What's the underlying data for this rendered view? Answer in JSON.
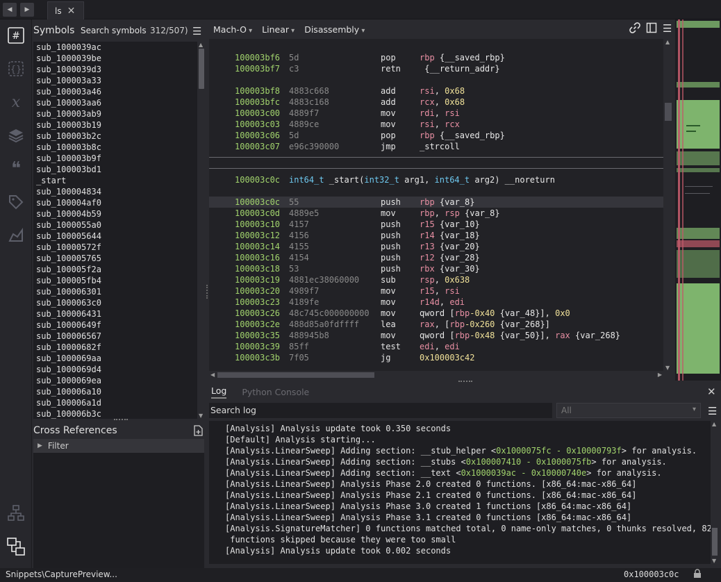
{
  "tab": {
    "title": "ls"
  },
  "symbols": {
    "title": "Symbols",
    "search_label": "Search symbols",
    "count": "312/507)",
    "items": [
      "sub_1000039ac",
      "sub_1000039be",
      "sub_1000039d3",
      "sub_100003a33",
      "sub_100003a46",
      "sub_100003aa6",
      "sub_100003ab9",
      "sub_100003b19",
      "sub_100003b2c",
      "sub_100003b8c",
      "sub_100003b9f",
      "sub_100003bd1",
      "_start",
      "sub_100004834",
      "sub_100004af0",
      "sub_100004b59",
      "sub_1000055a0",
      "sub_100005644",
      "sub_10000572f",
      "sub_100005765",
      "sub_100005f2a",
      "sub_100005fb4",
      "sub_100006301",
      "sub_1000063c0",
      "sub_100006431",
      "sub_10000649f",
      "sub_100006567",
      "sub_10000682f",
      "sub_1000069aa",
      "sub_1000069d4",
      "sub_1000069ea",
      "sub_100006a10",
      "sub_100006a1d",
      "sub_100006b3c"
    ]
  },
  "xrefs": {
    "title": "Cross References",
    "filter": "Filter"
  },
  "toolbar": {
    "format": "Mach-O",
    "layout": "Linear",
    "view": "Disassembly"
  },
  "disasm": {
    "block1": [
      {
        "addr": "100003bf6",
        "bytes": "5d",
        "mnem": "pop",
        "ops": [
          [
            "reg",
            "rbp "
          ],
          [
            "sym",
            "{__saved_rbp}"
          ]
        ]
      },
      {
        "addr": "100003bf7",
        "bytes": "c3",
        "mnem": "retn",
        "ops": [
          [
            "sym",
            " {__return_addr}"
          ]
        ]
      }
    ],
    "block2": [
      {
        "addr": "100003bf8",
        "bytes": "4883c668",
        "mnem": "add",
        "ops": [
          [
            "reg",
            "rsi"
          ],
          [
            "sym",
            ", "
          ],
          [
            "num",
            "0x68"
          ]
        ]
      },
      {
        "addr": "100003bfc",
        "bytes": "4883c168",
        "mnem": "add",
        "ops": [
          [
            "reg",
            "rcx"
          ],
          [
            "sym",
            ", "
          ],
          [
            "num",
            "0x68"
          ]
        ]
      },
      {
        "addr": "100003c00",
        "bytes": "4889f7",
        "mnem": "mov",
        "ops": [
          [
            "reg",
            "rdi"
          ],
          [
            "sym",
            ", "
          ],
          [
            "reg",
            "rsi"
          ]
        ]
      },
      {
        "addr": "100003c03",
        "bytes": "4889ce",
        "mnem": "mov",
        "ops": [
          [
            "reg",
            "rsi"
          ],
          [
            "sym",
            ", "
          ],
          [
            "reg",
            "rcx"
          ]
        ]
      },
      {
        "addr": "100003c06",
        "bytes": "5d",
        "mnem": "pop",
        "ops": [
          [
            "reg",
            "rbp "
          ],
          [
            "sym",
            "{__saved_rbp}"
          ]
        ]
      },
      {
        "addr": "100003c07",
        "bytes": "e96c390000",
        "mnem": "jmp",
        "ops": [
          [
            "sym",
            "_strcoll"
          ]
        ]
      }
    ],
    "func_header": {
      "addr": "100003c0c",
      "parts": [
        [
          "ty",
          "int64_t"
        ],
        [
          "sym",
          " _start("
        ],
        [
          "ty",
          "int32_t"
        ],
        [
          "sym",
          " arg1, "
        ],
        [
          "ty",
          "int64_t"
        ],
        [
          "sym",
          " arg2) __noreturn"
        ]
      ]
    },
    "block3": [
      {
        "addr": "100003c0c",
        "bytes": "55",
        "mnem": "push",
        "ops": [
          [
            "reg",
            "rbp "
          ],
          [
            "sym",
            "{var_8}"
          ]
        ]
      },
      {
        "addr": "100003c0d",
        "bytes": "4889e5",
        "mnem": "mov",
        "ops": [
          [
            "reg",
            "rbp"
          ],
          [
            "sym",
            ", "
          ],
          [
            "reg",
            "rsp "
          ],
          [
            "sym",
            "{var_8}"
          ]
        ]
      },
      {
        "addr": "100003c10",
        "bytes": "4157",
        "mnem": "push",
        "ops": [
          [
            "reg",
            "r15 "
          ],
          [
            "sym",
            "{var_10}"
          ]
        ]
      },
      {
        "addr": "100003c12",
        "bytes": "4156",
        "mnem": "push",
        "ops": [
          [
            "reg",
            "r14 "
          ],
          [
            "sym",
            "{var_18}"
          ]
        ]
      },
      {
        "addr": "100003c14",
        "bytes": "4155",
        "mnem": "push",
        "ops": [
          [
            "reg",
            "r13 "
          ],
          [
            "sym",
            "{var_20}"
          ]
        ]
      },
      {
        "addr": "100003c16",
        "bytes": "4154",
        "mnem": "push",
        "ops": [
          [
            "reg",
            "r12 "
          ],
          [
            "sym",
            "{var_28}"
          ]
        ]
      },
      {
        "addr": "100003c18",
        "bytes": "53",
        "mnem": "push",
        "ops": [
          [
            "reg",
            "rbx "
          ],
          [
            "sym",
            "{var_30}"
          ]
        ]
      },
      {
        "addr": "100003c19",
        "bytes": "4881ec38060000",
        "mnem": "sub",
        "ops": [
          [
            "reg",
            "rsp"
          ],
          [
            "sym",
            ", "
          ],
          [
            "num",
            "0x638"
          ]
        ]
      },
      {
        "addr": "100003c20",
        "bytes": "4989f7",
        "mnem": "mov",
        "ops": [
          [
            "reg",
            "r15"
          ],
          [
            "sym",
            ", "
          ],
          [
            "reg",
            "rsi"
          ]
        ]
      },
      {
        "addr": "100003c23",
        "bytes": "4189fe",
        "mnem": "mov",
        "ops": [
          [
            "reg",
            "r14d"
          ],
          [
            "sym",
            ", "
          ],
          [
            "reg",
            "edi"
          ]
        ]
      },
      {
        "addr": "100003c26",
        "bytes": "48c745c000000000",
        "mnem": "mov",
        "ops": [
          [
            "sym",
            "qword ["
          ],
          [
            "reg",
            "rbp"
          ],
          [
            "num",
            "-0x40"
          ],
          [
            "sym",
            " {var_48}], "
          ],
          [
            "num",
            "0x0"
          ]
        ]
      },
      {
        "addr": "100003c2e",
        "bytes": "488d85a0fdffff",
        "mnem": "lea",
        "ops": [
          [
            "reg",
            "rax"
          ],
          [
            "sym",
            ", ["
          ],
          [
            "reg",
            "rbp"
          ],
          [
            "num",
            "-0x260"
          ],
          [
            "sym",
            " {var_268}]"
          ]
        ]
      },
      {
        "addr": "100003c35",
        "bytes": "488945b8",
        "mnem": "mov",
        "ops": [
          [
            "sym",
            "qword ["
          ],
          [
            "reg",
            "rbp"
          ],
          [
            "num",
            "-0x48"
          ],
          [
            "sym",
            " {var_50}], "
          ],
          [
            "reg",
            "rax"
          ],
          [
            "sym",
            " {var_268}"
          ]
        ]
      },
      {
        "addr": "100003c39",
        "bytes": "85ff",
        "mnem": "test",
        "ops": [
          [
            "reg",
            "edi"
          ],
          [
            "sym",
            ", "
          ],
          [
            "reg",
            "edi"
          ]
        ]
      },
      {
        "addr": "100003c3b",
        "bytes": "7f05",
        "mnem": "jg",
        "ops": [
          [
            "num",
            "0x100003c42"
          ]
        ]
      }
    ]
  },
  "log": {
    "tab_log": "Log",
    "tab_python": "Python Console",
    "search_placeholder": "Search log",
    "filter_value": "All",
    "lines": [
      [
        [
          "t",
          "[Analysis] Analysis update took 0.350 seconds"
        ]
      ],
      [
        [
          "t",
          "[Default] Analysis starting..."
        ]
      ],
      [
        [
          "t",
          "[Analysis.LinearSweep] Adding section: __stub_helper <"
        ],
        [
          "a",
          "0x1000075fc - 0x10000793f"
        ],
        [
          "t",
          "> for analysis."
        ]
      ],
      [
        [
          "t",
          "[Analysis.LinearSweep] Adding section: __stubs <"
        ],
        [
          "a",
          "0x100007410 - 0x1000075fb"
        ],
        [
          "t",
          "> for analysis."
        ]
      ],
      [
        [
          "t",
          "[Analysis.LinearSweep] Adding section: __text <"
        ],
        [
          "a",
          "0x1000039ac - 0x10000740e"
        ],
        [
          "t",
          "> for analysis."
        ]
      ],
      [
        [
          "t",
          "[Analysis.LinearSweep] Analysis Phase 2.0 created 0 functions. [x86_64:mac-x86_64]"
        ]
      ],
      [
        [
          "t",
          "[Analysis.LinearSweep] Analysis Phase 2.1 created 0 functions. [x86_64:mac-x86_64]"
        ]
      ],
      [
        [
          "t",
          "[Analysis.LinearSweep] Analysis Phase 3.0 created 1 functions [x86_64:mac-x86_64]"
        ]
      ],
      [
        [
          "t",
          "[Analysis.LinearSweep] Analysis Phase 3.1 created 0 functions [x86_64:mac-x86_64]"
        ]
      ],
      [
        [
          "t",
          "[Analysis.SignatureMatcher] 0 functions matched total, 0 name-only matches, 0 thunks resolved, 82"
        ]
      ],
      [
        [
          "t",
          " functions skipped because they were too small"
        ]
      ],
      [
        [
          "t",
          "[Analysis] Analysis update took 0.002 seconds"
        ]
      ]
    ]
  },
  "status": {
    "left": "Snippets\\CapturePreview...",
    "address": "0x100003c0c"
  },
  "colors": {
    "address": "#a2d46d",
    "register": "#e88fa3",
    "number": "#f0e199",
    "type": "#6ec8ef",
    "minimap_green": "#8fcf7a",
    "minimap_red": "#c05a6a"
  }
}
